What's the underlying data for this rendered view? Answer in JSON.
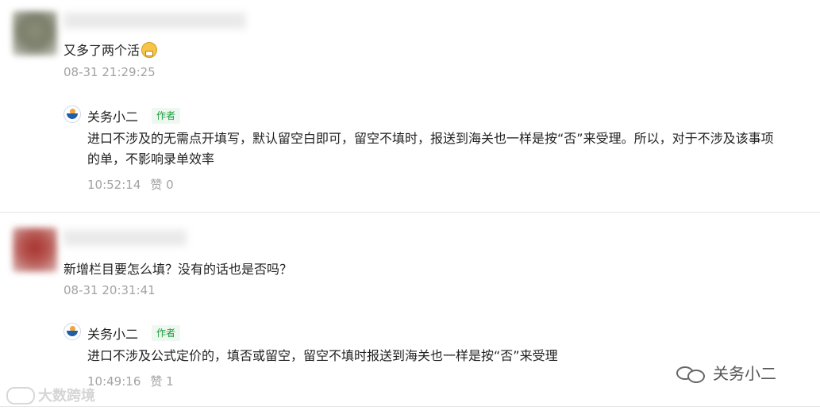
{
  "comments": [
    {
      "text": "又多了两个活",
      "emoji": "grinning-face-emoji",
      "time": "08-31 21:29:25",
      "reply": {
        "author": "关务小二",
        "badge": "作者",
        "text_line1": "进口不涉及的无需点开填写，默认留空白即可，留空不填时，报送到海关也一样是按“否”来受理。所以，对于不涉及该事项",
        "text_line2": "的单，不影响录单效率",
        "time": "10:52:14",
        "likes": "赞 0"
      }
    },
    {
      "text": "新增栏目要怎么填？没有的话也是否吗？",
      "time": "08-31 20:31:41",
      "reply": {
        "author": "关务小二",
        "badge": "作者",
        "text_line1": "进口不涉及公式定价的，填否或留空，留空不填时报送到海关也一样是按“否”来受理",
        "time": "10:49:16",
        "likes": "赞 1"
      }
    }
  ],
  "watermarks": {
    "right": "关务小二",
    "left": "大数跨境"
  },
  "colors": {
    "badge_text": "#1a9e3b",
    "badge_bg": "#eef7f0",
    "meta_text": "#a3a3a3"
  }
}
